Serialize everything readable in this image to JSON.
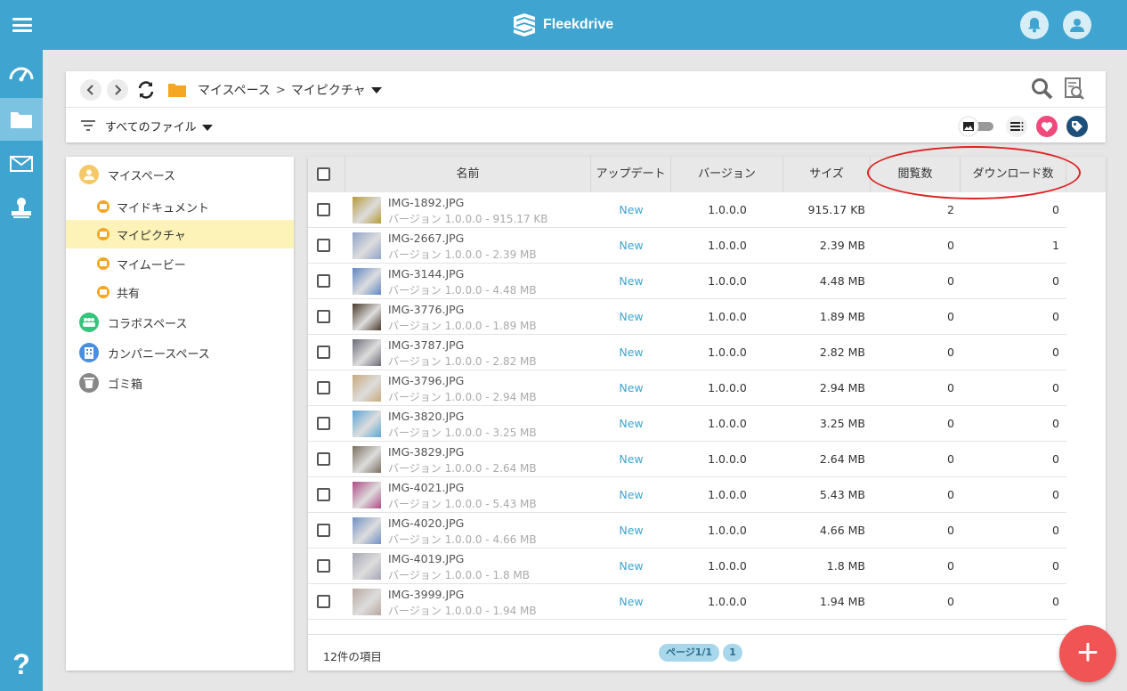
{
  "app": {
    "brand_name": "Fleekdrive"
  },
  "breadcrumb": {
    "root": "マイスペース",
    "separator": ">",
    "current": "マイピクチャ"
  },
  "filter": {
    "label": "すべてのファイル"
  },
  "sidebar": {
    "items": [
      {
        "label": "マイスペース",
        "color": "#f5c86a"
      },
      {
        "label": "マイドキュメント"
      },
      {
        "label": "マイピクチャ"
      },
      {
        "label": "マイムービー"
      },
      {
        "label": "共有"
      },
      {
        "label": "コラボスペース",
        "color": "#35c47c"
      },
      {
        "label": "カンパニースペース",
        "color": "#4a8ee0"
      },
      {
        "label": "ゴミ箱",
        "color": "#888888"
      }
    ]
  },
  "table": {
    "columns": [
      "名前",
      "アップデート",
      "バージョン",
      "サイズ",
      "閲覧数",
      "ダウンロード数"
    ],
    "rows": [
      {
        "name": "IMG-1892.JPG",
        "meta": "バージョン 1.0.0.0 - 915.17 KB",
        "update": "New",
        "version": "1.0.0.0",
        "size": "915.17 KB",
        "views": "2",
        "downloads": "0",
        "thumb": "#b59a3a"
      },
      {
        "name": "IMG-2667.JPG",
        "meta": "バージョン 1.0.0.0 - 2.39 MB",
        "update": "New",
        "version": "1.0.0.0",
        "size": "2.39 MB",
        "views": "0",
        "downloads": "1",
        "thumb": "#8fa3c8"
      },
      {
        "name": "IMG-3144.JPG",
        "meta": "バージョン 1.0.0.0 - 4.48 MB",
        "update": "New",
        "version": "1.0.0.0",
        "size": "4.48 MB",
        "views": "0",
        "downloads": "0",
        "thumb": "#5f86c5"
      },
      {
        "name": "IMG-3776.JPG",
        "meta": "バージョン 1.0.0.0 - 1.89 MB",
        "update": "New",
        "version": "1.0.0.0",
        "size": "1.89 MB",
        "views": "0",
        "downloads": "0",
        "thumb": "#4a3a2a"
      },
      {
        "name": "IMG-3787.JPG",
        "meta": "バージョン 1.0.0.0 - 2.82 MB",
        "update": "New",
        "version": "1.0.0.0",
        "size": "2.82 MB",
        "views": "0",
        "downloads": "0",
        "thumb": "#6b6b78"
      },
      {
        "name": "IMG-3796.JPG",
        "meta": "バージョン 1.0.0.0 - 2.94 MB",
        "update": "New",
        "version": "1.0.0.0",
        "size": "2.94 MB",
        "views": "0",
        "downloads": "0",
        "thumb": "#c8a97a"
      },
      {
        "name": "IMG-3820.JPG",
        "meta": "バージョン 1.0.0.0 - 3.25 MB",
        "update": "New",
        "version": "1.0.0.0",
        "size": "3.25 MB",
        "views": "0",
        "downloads": "0",
        "thumb": "#5aa6d6"
      },
      {
        "name": "IMG-3829.JPG",
        "meta": "バージョン 1.0.0.0 - 2.64 MB",
        "update": "New",
        "version": "1.0.0.0",
        "size": "2.64 MB",
        "views": "0",
        "downloads": "0",
        "thumb": "#7a6f5f"
      },
      {
        "name": "IMG-4021.JPG",
        "meta": "バージョン 1.0.0.0 - 5.43 MB",
        "update": "New",
        "version": "1.0.0.0",
        "size": "5.43 MB",
        "views": "0",
        "downloads": "0",
        "thumb": "#b04a86"
      },
      {
        "name": "IMG-4020.JPG",
        "meta": "バージョン 1.0.0.0 - 4.66 MB",
        "update": "New",
        "version": "1.0.0.0",
        "size": "4.66 MB",
        "views": "0",
        "downloads": "0",
        "thumb": "#6f8fc4"
      },
      {
        "name": "IMG-4019.JPG",
        "meta": "バージョン 1.0.0.0 - 1.8 MB",
        "update": "New",
        "version": "1.0.0.0",
        "size": "1.8 MB",
        "views": "0",
        "downloads": "0",
        "thumb": "#a7a7b5"
      },
      {
        "name": "IMG-3999.JPG",
        "meta": "バージョン 1.0.0.0 - 1.94 MB",
        "update": "New",
        "version": "1.0.0.0",
        "size": "1.94 MB",
        "views": "0",
        "downloads": "0",
        "thumb": "#b9a8a0"
      }
    ]
  },
  "footer": {
    "count": "12件の項目",
    "page_label": "ページ1/1",
    "page_number": "1"
  },
  "colors": {
    "brand": "#3fa5d0",
    "fab": "#f05454",
    "highlight": "#e02020"
  }
}
